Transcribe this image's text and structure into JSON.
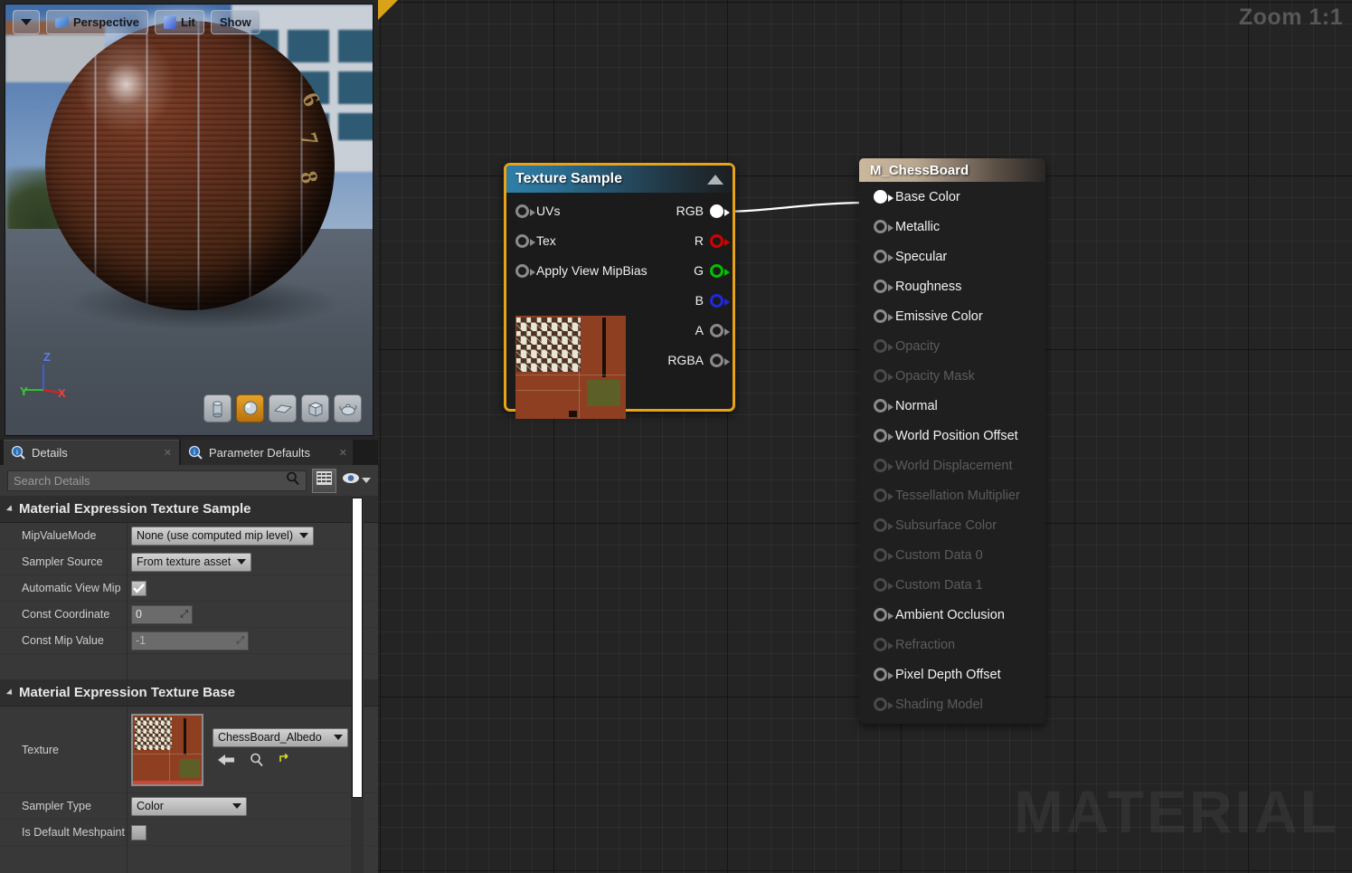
{
  "viewport": {
    "toolbar": {
      "dropdown_icon": "chevron-down-icon",
      "perspective_label": "Perspective",
      "perspective_icon": "camera-icon",
      "lit_label": "Lit",
      "lit_icon": "cube-icon",
      "show_label": "Show"
    },
    "gizmo": {
      "z": "Z",
      "y": "Y",
      "x": "X"
    },
    "sphere_digits": [
      "6",
      "7",
      "8"
    ],
    "shape_buttons": [
      {
        "name": "cylinder",
        "icon": "cylinder-icon",
        "active": false
      },
      {
        "name": "sphere",
        "icon": "sphere-icon",
        "active": true
      },
      {
        "name": "plane",
        "icon": "plane-icon",
        "active": false
      },
      {
        "name": "cube",
        "icon": "cube-icon",
        "active": false
      },
      {
        "name": "teapot",
        "icon": "teapot-icon",
        "active": false
      }
    ]
  },
  "details_panel": {
    "tabs": [
      {
        "label": "Details",
        "active": true,
        "icon": "magnifier-info-icon"
      },
      {
        "label": "Parameter Defaults",
        "active": false,
        "icon": "magnifier-info-icon"
      }
    ],
    "search": {
      "placeholder": "Search Details",
      "icon": "search-icon"
    },
    "toolbar_icons": [
      "grid-view-icon",
      "eye-icon",
      "chevron-down-icon"
    ],
    "categories": [
      {
        "title": "Material Expression Texture Sample",
        "rows": [
          {
            "label": "MipValueMode",
            "type": "combo",
            "value": "None (use computed mip level)"
          },
          {
            "label": "Sampler Source",
            "type": "combo",
            "value": "From texture asset"
          },
          {
            "label": "Automatic View Mip",
            "type": "checkbox",
            "value": "checked"
          },
          {
            "label": "Const Coordinate",
            "type": "number",
            "value": "0"
          },
          {
            "label": "Const Mip Value",
            "type": "number-wide",
            "value": "-1"
          }
        ]
      },
      {
        "title": "Material Expression Texture Base",
        "rows": [
          {
            "label": "Texture",
            "type": "asset",
            "value": "ChessBoard_Albedo",
            "buttons": [
              "back-arrow-icon",
              "browse-icon",
              "reset-icon"
            ]
          },
          {
            "label": "Sampler Type",
            "type": "combo",
            "value": "Color"
          },
          {
            "label": "Is Default Meshpaint",
            "type": "checkbox",
            "value": "unchecked"
          }
        ]
      }
    ]
  },
  "graph": {
    "zoom_label": "Zoom 1:1",
    "watermark": "MATERIAL",
    "texture_node": {
      "title": "Texture Sample",
      "collapse_icon": "chevron-up-icon",
      "selected": true,
      "inputs": [
        {
          "label": "UVs",
          "connected": false
        },
        {
          "label": "Tex",
          "connected": false
        },
        {
          "label": "Apply View MipBias",
          "connected": false
        }
      ],
      "outputs": [
        {
          "label": "RGB",
          "color": "#ffffff",
          "connected": true
        },
        {
          "label": "R",
          "color": "#d40000",
          "connected": false
        },
        {
          "label": "G",
          "color": "#00c000",
          "connected": false
        },
        {
          "label": "B",
          "color": "#2028e0",
          "connected": false
        },
        {
          "label": "A",
          "color": "#8a8a8a",
          "connected": false
        },
        {
          "label": "RGBA",
          "color": "#8a8a8a",
          "connected": false
        }
      ]
    },
    "material_node": {
      "title": "M_ChessBoard",
      "inputs": [
        {
          "label": "Base Color",
          "enabled": true,
          "connected": true
        },
        {
          "label": "Metallic",
          "enabled": true,
          "connected": false
        },
        {
          "label": "Specular",
          "enabled": true,
          "connected": false
        },
        {
          "label": "Roughness",
          "enabled": true,
          "connected": false
        },
        {
          "label": "Emissive Color",
          "enabled": true,
          "connected": false
        },
        {
          "label": "Opacity",
          "enabled": false,
          "connected": false
        },
        {
          "label": "Opacity Mask",
          "enabled": false,
          "connected": false
        },
        {
          "label": "Normal",
          "enabled": true,
          "connected": false
        },
        {
          "label": "World Position Offset",
          "enabled": true,
          "connected": false
        },
        {
          "label": "World Displacement",
          "enabled": false,
          "connected": false
        },
        {
          "label": "Tessellation Multiplier",
          "enabled": false,
          "connected": false
        },
        {
          "label": "Subsurface Color",
          "enabled": false,
          "connected": false
        },
        {
          "label": "Custom Data 0",
          "enabled": false,
          "connected": false
        },
        {
          "label": "Custom Data 1",
          "enabled": false,
          "connected": false
        },
        {
          "label": "Ambient Occlusion",
          "enabled": true,
          "connected": false
        },
        {
          "label": "Refraction",
          "enabled": false,
          "connected": false
        },
        {
          "label": "Pixel Depth Offset",
          "enabled": true,
          "connected": false
        },
        {
          "label": "Shading Model",
          "enabled": false,
          "connected": false
        }
      ]
    }
  },
  "colors": {
    "selection_gold": "#e8a317",
    "node_header_blue": "#2f7fa8",
    "node_header_tan": "#cbb99e",
    "wire_white": "#ffffff",
    "graph_bg": "#242424"
  }
}
